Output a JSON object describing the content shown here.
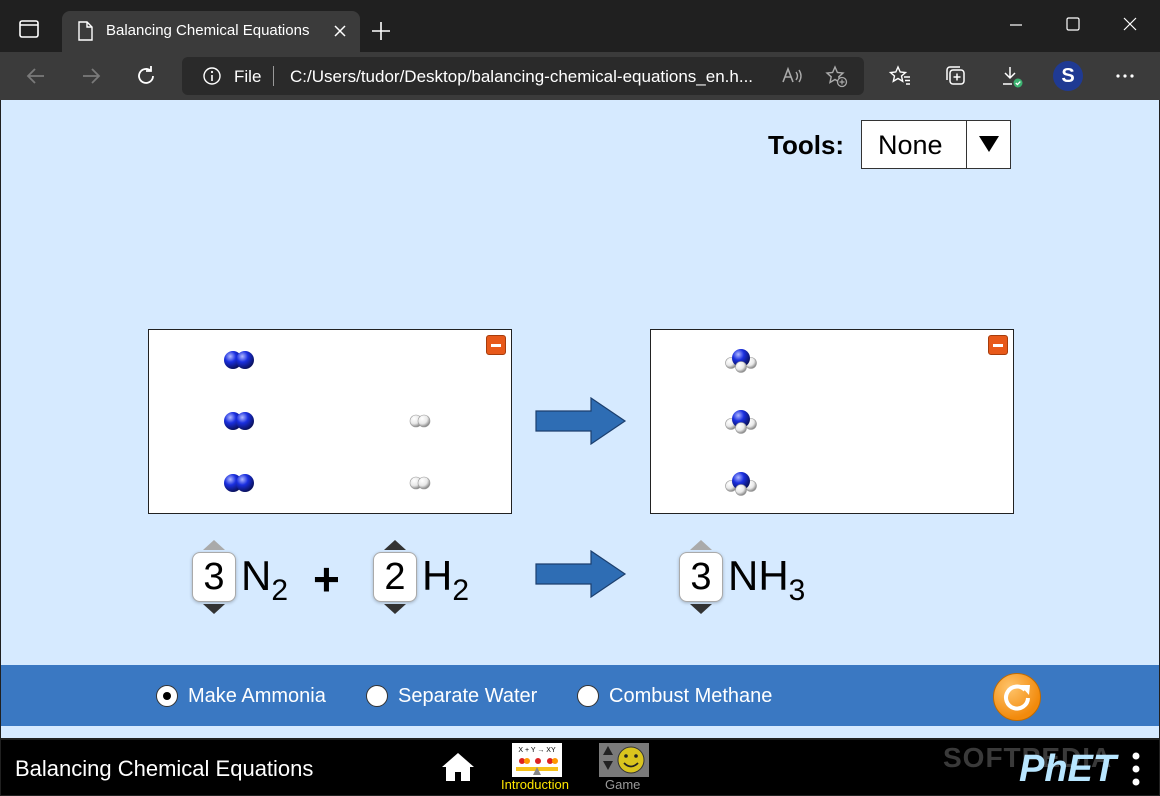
{
  "browser": {
    "tab_title": "Balancing Chemical Equations",
    "address_file": "File",
    "address_url": "C:/Users/tudor/Desktop/balancing-chemical-equations_en.h...",
    "profile_initial": "S"
  },
  "tools": {
    "label": "Tools:",
    "selected": "None"
  },
  "equation": {
    "reactant1": {
      "coefficient": "3",
      "symbol": "N",
      "subscript": "2"
    },
    "plus": "+",
    "reactant2": {
      "coefficient": "2",
      "symbol": "H",
      "subscript": "2"
    },
    "product1": {
      "coefficient": "3",
      "symbol": "NH",
      "subscript": "3"
    }
  },
  "modes": [
    {
      "label": "Make Ammonia",
      "selected": true
    },
    {
      "label": "Separate Water",
      "selected": false
    },
    {
      "label": "Combust Methane",
      "selected": false
    }
  ],
  "navbar": {
    "title": "Balancing Chemical Equations",
    "screens": [
      {
        "label": "Introduction",
        "active": true
      },
      {
        "label": "Game",
        "active": false
      }
    ],
    "watermark": "SOFTPEDIA",
    "brand": "PhET"
  },
  "colors": {
    "sim_background": "#d6eaff",
    "mode_bar": "#3a78c2",
    "arrow_fill": "#2e6db4",
    "nitrogen": "#1a2fe0",
    "hydrogen": "#ffffff",
    "active_screen_label": "#ffe600",
    "minimize_button": "#e8591a"
  },
  "icons": [
    "tab-switcher-icon",
    "document-icon",
    "close-icon",
    "plus-icon",
    "minimize-window-icon",
    "maximize-window-icon",
    "close-window-icon",
    "back-icon",
    "forward-icon",
    "refresh-icon",
    "info-icon",
    "read-aloud-icon",
    "add-favorite-icon",
    "favorites-icon",
    "collections-icon",
    "downloads-icon",
    "more-icon",
    "dropdown-arrow-icon",
    "minimize-box-icon",
    "reaction-arrow-icon",
    "spinner-up-icon",
    "spinner-down-icon",
    "reset-icon",
    "home-icon",
    "menu-icon"
  ]
}
